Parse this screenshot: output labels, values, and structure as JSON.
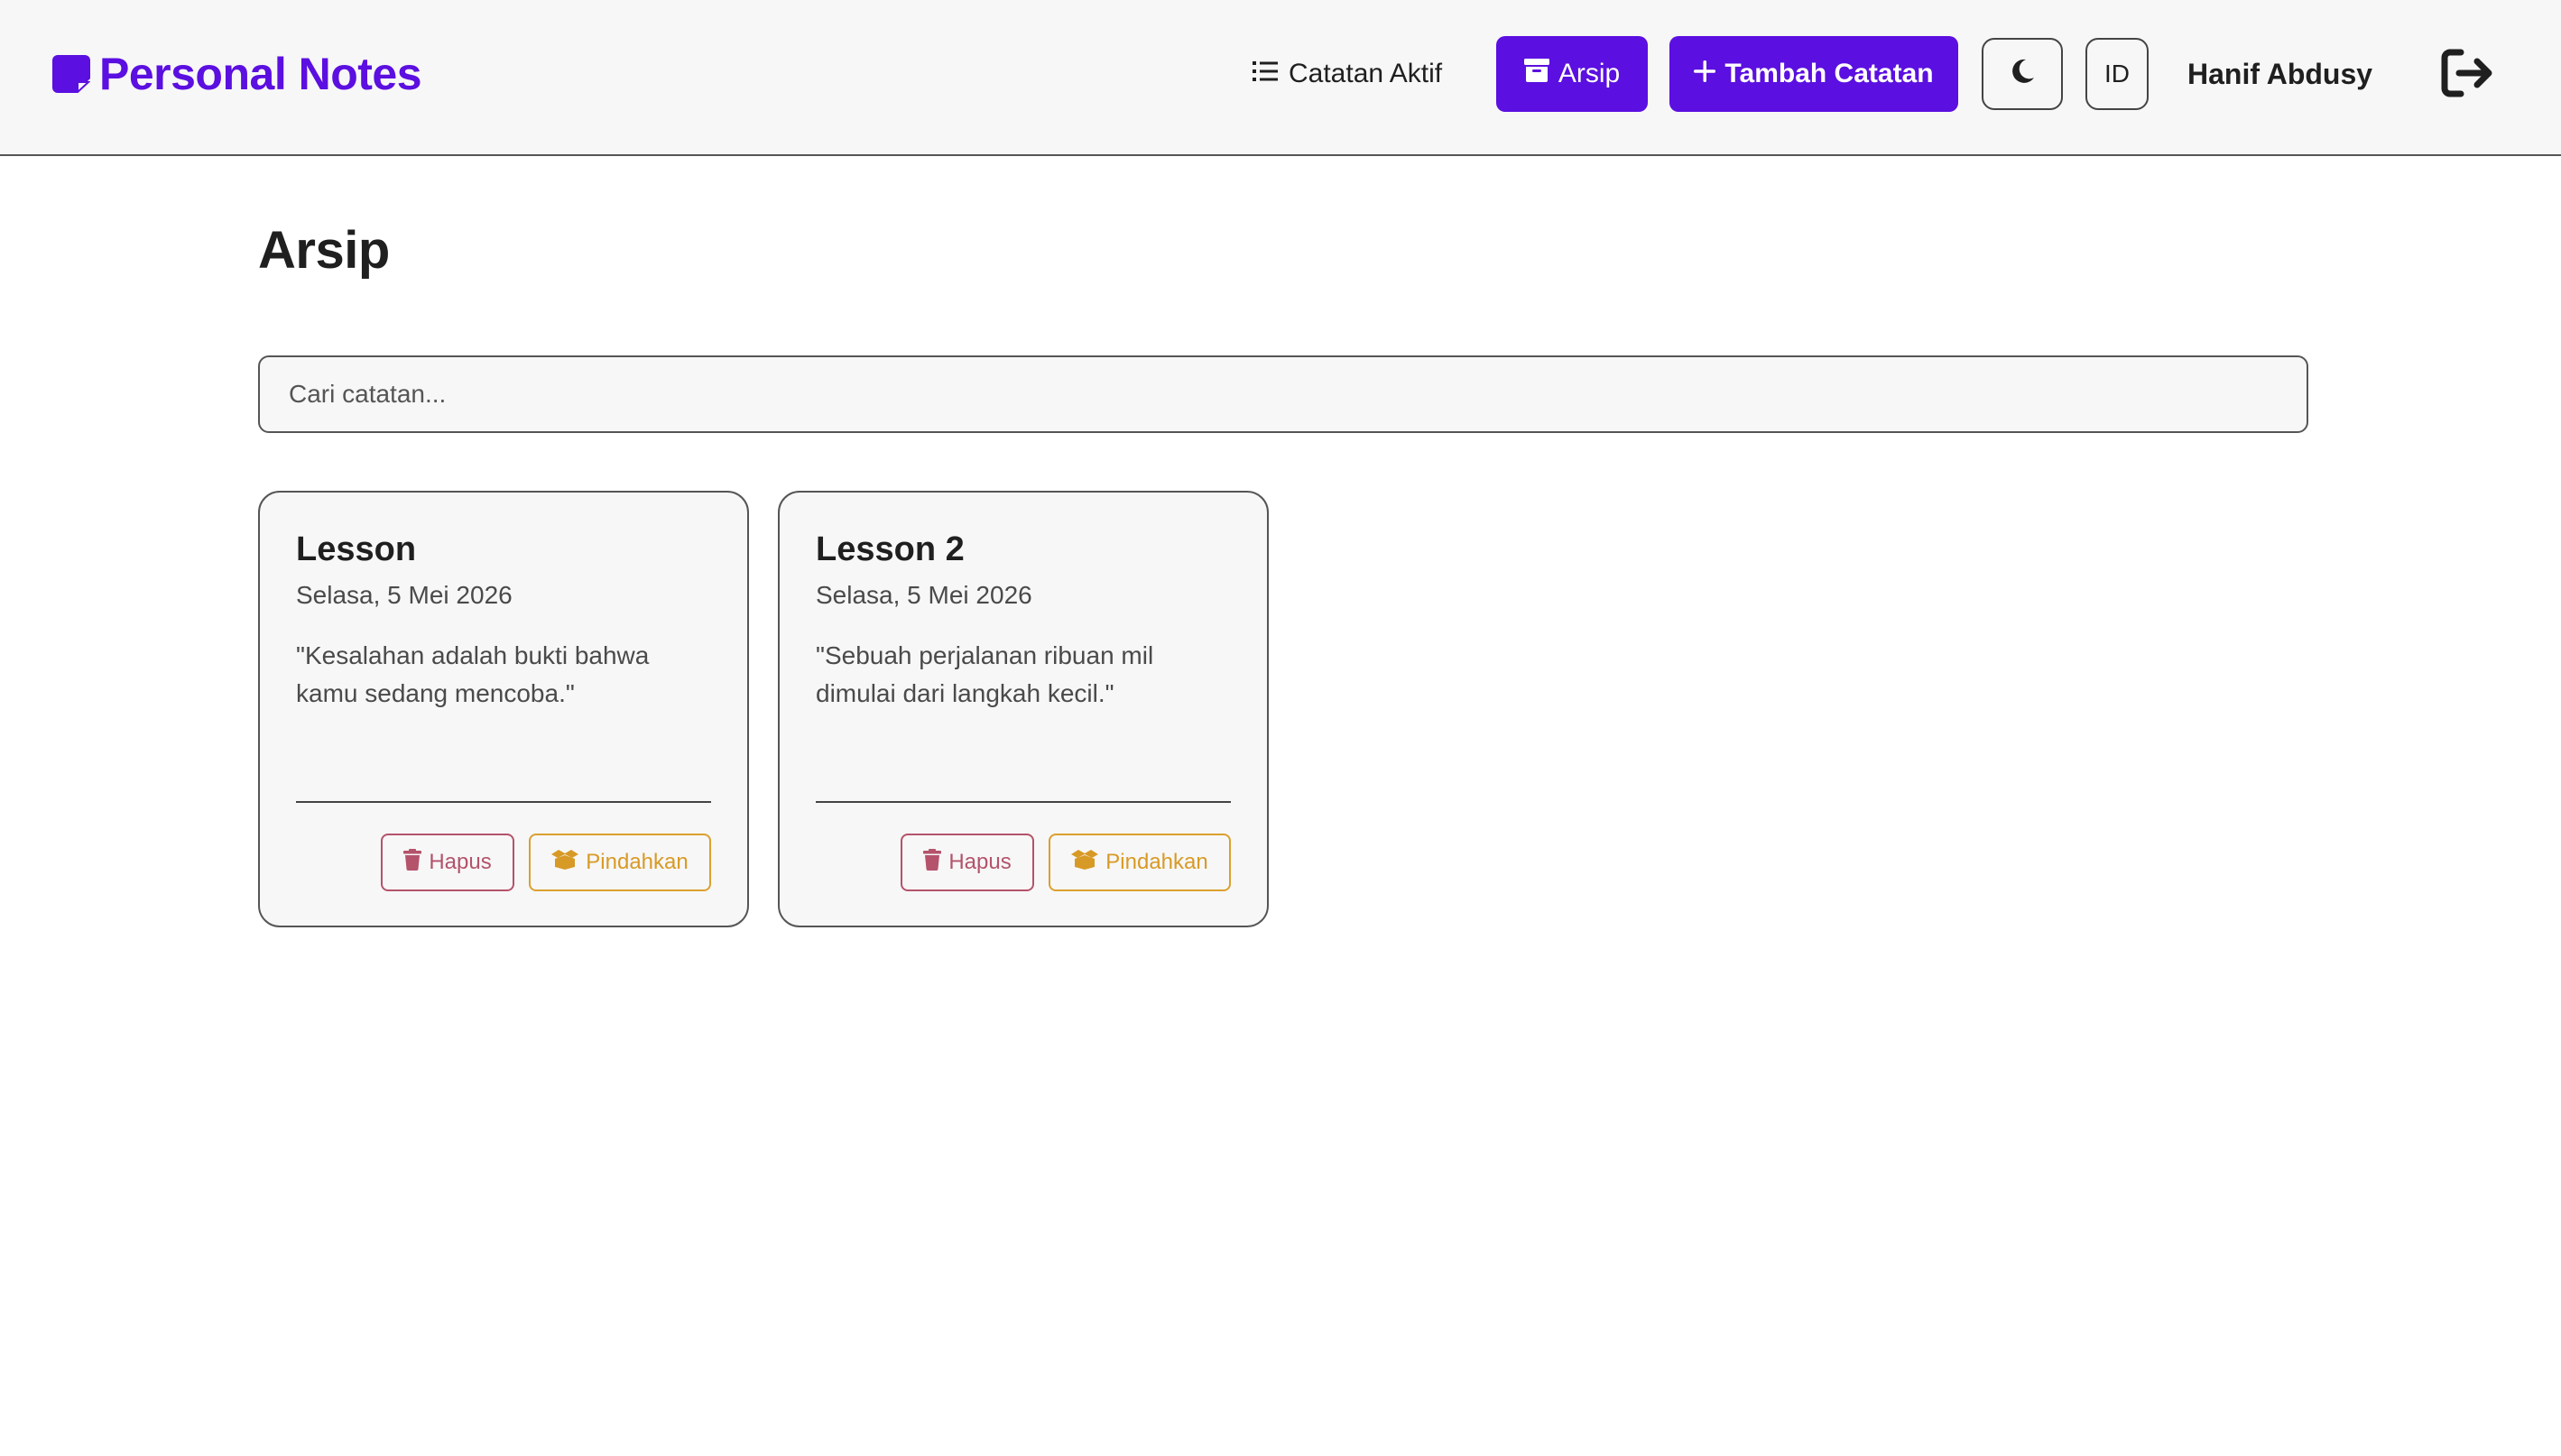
{
  "app": {
    "brand": "Personal Notes"
  },
  "nav": {
    "active_notes_label": "Catatan Aktif",
    "archive_label": "Arsip",
    "add_note_label": "Tambah Catatan",
    "language_label": "ID",
    "username": "Hanif Abdusy",
    "icons": {
      "brand": "note-icon",
      "active_notes": "list-icon",
      "archive": "archive-icon",
      "add": "plus-icon",
      "theme": "moon-icon",
      "logout": "logout-icon"
    }
  },
  "page": {
    "title": "Arsip"
  },
  "search": {
    "placeholder": "Cari catatan...",
    "value": ""
  },
  "notes": [
    {
      "title": "Lesson",
      "date": "Selasa, 5 Mei 2026",
      "body": "\"Kesalahan adalah bukti bahwa kamu sedang mencoba.\"",
      "delete_label": "Hapus",
      "move_label": "Pindahkan"
    },
    {
      "title": "Lesson 2",
      "date": "Selasa, 5 Mei 2026",
      "body": "\"Sebuah perjalanan ribuan mil dimulai dari langkah kecil.\"",
      "delete_label": "Hapus",
      "move_label": "Pindahkan"
    }
  ],
  "colors": {
    "brand": "#5b0fe0",
    "delete": "#b4536b",
    "move": "#d89a26",
    "header_bg": "#f7f7f7"
  }
}
